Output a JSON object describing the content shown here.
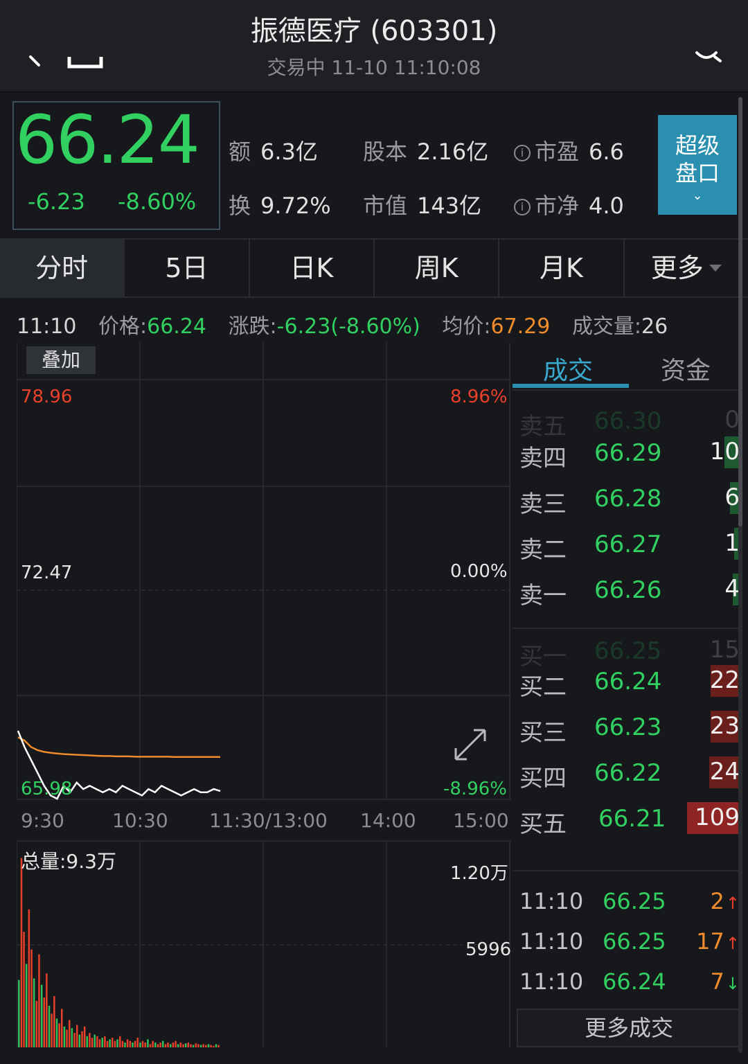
{
  "header": {
    "title": "振德医疗 (603301)",
    "subtitle": "交易中 11-10 11:10:08"
  },
  "quote": {
    "price": "66.24",
    "change": "-6.23",
    "change_pct": "-8.60%",
    "stats": {
      "amount_label": "额",
      "amount": "6.3亿",
      "equity_label": "股本",
      "equity": "2.16亿",
      "pe_label": "市盈",
      "pe": "6.6",
      "turnover_label": "换",
      "turnover": "9.72%",
      "mktcap_label": "市值",
      "mktcap": "143亿",
      "pb_label": "市净",
      "pb": "4.0",
      "info_glyph": "i"
    },
    "super_button": {
      "line1": "超级",
      "line2": "盘口"
    }
  },
  "tabs": [
    {
      "label": "分时"
    },
    {
      "label": "5日"
    },
    {
      "label": "日K"
    },
    {
      "label": "周K"
    },
    {
      "label": "月K"
    },
    {
      "label": "更多"
    }
  ],
  "info_line": {
    "time": "11:10",
    "price_label": "价格:",
    "price": "66.24",
    "chg_label": "涨跌:",
    "chg": "-6.23(-8.60%)",
    "avg_label": "均价:",
    "avg": "67.29",
    "vol_label": "成交量:",
    "vol": "26"
  },
  "chart": {
    "overlay_label": "叠加",
    "price_high": "78.96",
    "price_mid": "72.47",
    "price_low": "65.98",
    "pct_high": "8.96%",
    "pct_mid": "0.00%",
    "pct_low": "-8.96%",
    "time_labels": [
      "9:30",
      "10:30",
      "11:30/13:00",
      "14:00",
      "15:00"
    ],
    "total_volume_label": "总量:9.3万",
    "vol_max_label": "1.20万",
    "vol_mid_label": "5996",
    "colors": {
      "price_line": "#ffffff",
      "avg_line": "#ef8d2c",
      "grid": "#2b2d32"
    }
  },
  "chart_data": {
    "type": "line",
    "title": "",
    "xlabel": "",
    "ylabel": "",
    "ylim": [
      65.98,
      78.96
    ],
    "x_ticks": [
      "9:30",
      "10:30",
      "11:30/13:00",
      "14:00",
      "15:00"
    ],
    "series": [
      {
        "values": [
          68.1,
          67.6,
          67.2,
          66.8,
          66.4,
          66.1,
          66.0,
          66.4,
          66.2,
          66.5,
          66.3,
          66.4,
          66.3,
          66.2,
          66.3,
          66.2,
          66.4,
          66.3,
          66.2,
          66.1,
          66.3,
          66.2,
          66.4,
          66.3,
          66.2,
          66.1,
          66.2,
          66.3,
          66.2,
          66.2,
          66.3,
          66.24
        ]
      },
      {
        "values": [
          67.9,
          67.8,
          67.6,
          67.5,
          67.45,
          67.42,
          67.4,
          67.38,
          67.37,
          67.36,
          67.35,
          67.34,
          67.33,
          67.32,
          67.32,
          67.31,
          67.31,
          67.31,
          67.3,
          67.3,
          67.3,
          67.3,
          67.3,
          67.3,
          67.29,
          67.29,
          67.29,
          67.29,
          67.29,
          67.29,
          67.29,
          67.29
        ]
      }
    ],
    "volume": [
      4200,
      11800,
      7200,
      5200,
      8600,
      6100,
      4300,
      2900,
      5800,
      3900,
      3100,
      4600,
      2600,
      2100,
      3200,
      1800,
      1500,
      2400,
      1300,
      1100,
      1700,
      1200,
      900,
      1400,
      800,
      1000,
      1300,
      700,
      900,
      600,
      800,
      700,
      500,
      600,
      700,
      400,
      500,
      600,
      400,
      500,
      700,
      400,
      300,
      500,
      400,
      300,
      400,
      600,
      300,
      400,
      300,
      500,
      200,
      400,
      300,
      200,
      300,
      400,
      200,
      300,
      200,
      300,
      400,
      200,
      300,
      200,
      250,
      300,
      200,
      150,
      250,
      200,
      150,
      200,
      150,
      200,
      150,
      100,
      200,
      150
    ]
  },
  "right_panel": {
    "tab_trades": "成交",
    "tab_funds": "资金",
    "asks": [
      {
        "label": "卖五",
        "price": "66.30",
        "vol": "0"
      },
      {
        "label": "卖四",
        "price": "66.29",
        "vol": "10"
      },
      {
        "label": "卖三",
        "price": "66.28",
        "vol": "6"
      },
      {
        "label": "卖二",
        "price": "66.27",
        "vol": "1"
      },
      {
        "label": "卖一",
        "price": "66.26",
        "vol": "4"
      }
    ],
    "bids": [
      {
        "label": "买一",
        "price": "66.25",
        "vol": "15"
      },
      {
        "label": "买二",
        "price": "66.24",
        "vol": "22"
      },
      {
        "label": "买三",
        "price": "66.23",
        "vol": "23"
      },
      {
        "label": "买四",
        "price": "66.22",
        "vol": "24"
      },
      {
        "label": "买五",
        "price": "66.21",
        "vol": "109"
      }
    ],
    "ticks": [
      {
        "time": "11:10",
        "price": "66.25",
        "vol": "2",
        "dir": "up"
      },
      {
        "time": "11:10",
        "price": "66.25",
        "vol": "17",
        "dir": "up"
      },
      {
        "time": "11:10",
        "price": "66.24",
        "vol": "7",
        "dir": "down"
      }
    ],
    "more_trades": "更多成交",
    "colors": {
      "ask_bar": "#1e5a2f",
      "bid_bar": "#6b1f1d",
      "bid_bar_big": "#8f2523"
    }
  }
}
